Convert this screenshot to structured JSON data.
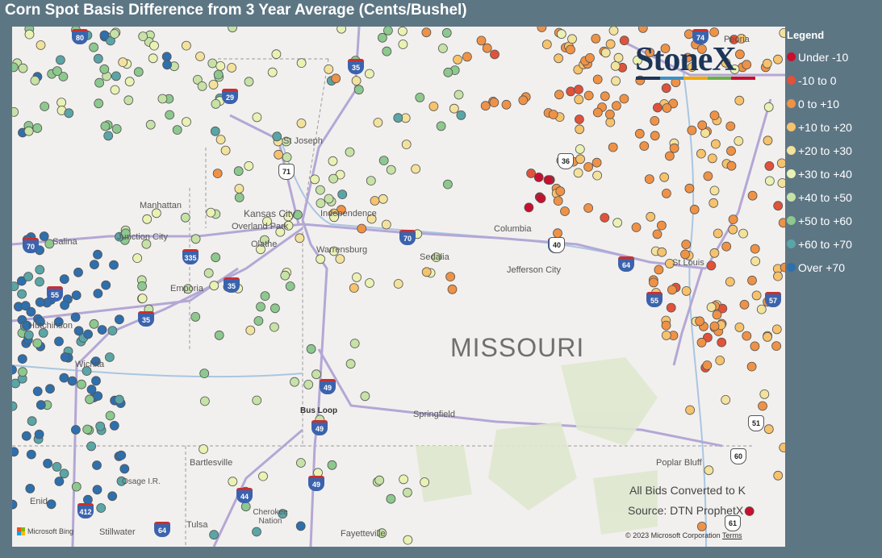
{
  "title": "Corn Spot Basis Difference from 3 Year Average (Cents/Bushel)",
  "legend": {
    "title": "Legend",
    "items": [
      {
        "label": "Under -10",
        "color": "#c8102e"
      },
      {
        "label": "-10 to 0",
        "color": "#e0523a"
      },
      {
        "label": "0 to +10",
        "color": "#ef9246"
      },
      {
        "label": "+10 to +20",
        "color": "#f6c26c"
      },
      {
        "label": "+20 to +30",
        "color": "#f3e29c"
      },
      {
        "label": "+30 to +40",
        "color": "#eaf2b3"
      },
      {
        "label": "+40 to +50",
        "color": "#c6e2a6"
      },
      {
        "label": "+50 to +60",
        "color": "#8dc88e"
      },
      {
        "label": "+60 to +70",
        "color": "#5aa5a5"
      },
      {
        "label": "Over +70",
        "color": "#2e6fad"
      }
    ]
  },
  "map": {
    "state_label": "MISSOURI",
    "places": [
      "St Joseph",
      "Manhattan",
      "Kansas City",
      "Independence",
      "Overland Park",
      "Olathe",
      "Junction City",
      "Salina",
      "Emporia",
      "Warrensburg",
      "Sedalia",
      "Columbia",
      "Jefferson City",
      "St Louis",
      "Springfield",
      "Hutchinson",
      "Wichita",
      "Bartlesville",
      "Osage I.R.",
      "Tulsa",
      "Cherokee Nation",
      "Stillwater",
      "Enid",
      "Fayetteville",
      "Poplar Bluff",
      "Peoria",
      "Bus Loop"
    ],
    "shields": [
      "80",
      "35",
      "29",
      "70",
      "335",
      "35",
      "35",
      "70",
      "64",
      "55",
      "57",
      "44",
      "49",
      "49",
      "49",
      "74",
      "55",
      "412",
      "64",
      "40"
    ],
    "us_highways": [
      "71",
      "36",
      "40",
      "51",
      "60",
      "61"
    ],
    "logo_text": "StoneX",
    "logo_colors": [
      "#1d3557",
      "#3f8fc4",
      "#f2a900",
      "#6cae4a",
      "#c8102e"
    ],
    "notes": [
      "All Bids Converted to K",
      "Source: DTN ProphetX"
    ],
    "attribution": "Microsoft Bing",
    "copyright": "© 2023 Microsoft Corporation",
    "terms": "Terms"
  }
}
